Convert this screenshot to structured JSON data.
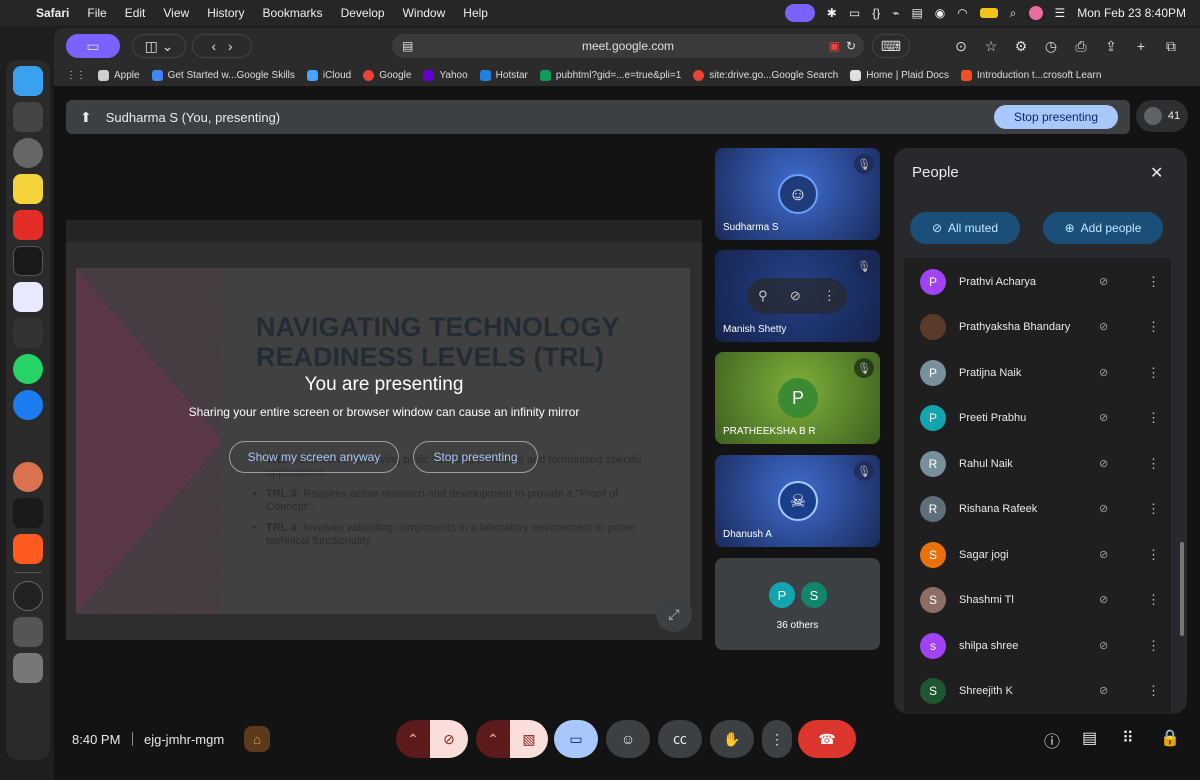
{
  "menubar": {
    "app": "Safari",
    "menus": [
      "File",
      "Edit",
      "View",
      "History",
      "Bookmarks",
      "Develop",
      "Window",
      "Help"
    ],
    "datetime": "Mon Feb 23  8:40PM"
  },
  "browser": {
    "url": "meet.google.com",
    "bookmarks": [
      {
        "label": "Apple",
        "color": "#d0d0d0"
      },
      {
        "label": "Get Started w...Google Skills",
        "color": "#4285f4"
      },
      {
        "label": "iCloud",
        "color": "#4aa3ff"
      },
      {
        "label": "Google",
        "color": "#ea4335"
      },
      {
        "label": "Yahoo",
        "color": "#6001d2"
      },
      {
        "label": "Hotstar",
        "color": "#1f80e0"
      },
      {
        "label": "pubhtml?gid=...e=true&pli=1",
        "color": "#0f9d58"
      },
      {
        "label": "site:drive.go...Google Search",
        "color": "#ea4335"
      },
      {
        "label": "Home | Plaid Docs",
        "color": "#e0e0e0"
      },
      {
        "label": "Introduction t...crosoft Learn",
        "color": "#f25022"
      }
    ]
  },
  "presenting_bar": {
    "text": "Sudharma S (You, presenting)",
    "stop_label": "Stop presenting",
    "participant_count": "41"
  },
  "stage": {
    "slide_title": "NAVIGATING TECHNOLOGY READINESS LEVELS (TRL)",
    "bullets": [
      {
        "strong": "TRL 1-2:",
        "text": " Involve identifying basic scientific principles and formulating specific applications."
      },
      {
        "strong": "TRL 3:",
        "text": " Requires active research and development to provide a \"Proof of Concept\"."
      },
      {
        "strong": "TRL 4:",
        "text": " Involves validating components in a laboratory environment to prove technical functionality."
      }
    ],
    "overlay_title": "You are presenting",
    "overlay_sub": "Sharing your entire screen or browser window can cause an infinity mirror",
    "show_anyway": "Show my screen anyway",
    "stop_presenting": "Stop presenting"
  },
  "tiles": [
    {
      "name": "Sudharma S"
    },
    {
      "name": "Manish Shetty"
    },
    {
      "name": "PRATHEEKSHA B R",
      "initial": "P"
    },
    {
      "name": "Dhanush A"
    },
    {
      "others": "36 others",
      "initials": [
        "P",
        "S"
      ]
    }
  ],
  "people_panel": {
    "title": "People",
    "all_muted": "All muted",
    "add_people": "Add people",
    "people": [
      {
        "name": "Prathvi Acharya",
        "initial": "P",
        "color": "#a142f4"
      },
      {
        "name": "Prathyaksha Bhandary",
        "initial": "",
        "color": "#5a3a2a"
      },
      {
        "name": "Pratijna Naik",
        "initial": "P",
        "color": "#78909c"
      },
      {
        "name": "Preeti Prabhu",
        "initial": "P",
        "color": "#12a4af"
      },
      {
        "name": "Rahul Naik",
        "initial": "R",
        "color": "#78909c"
      },
      {
        "name": "Rishana Rafeek",
        "initial": "R",
        "color": "#5f6f7a"
      },
      {
        "name": "Sagar jogi",
        "initial": "S",
        "color": "#e8710a"
      },
      {
        "name": "Shashmi Tl",
        "initial": "S",
        "color": "#8d6e63"
      },
      {
        "name": "shilpa shree",
        "initial": "s",
        "color": "#a142f4"
      },
      {
        "name": "Shreejith K",
        "initial": "S",
        "color": "#1e5631"
      }
    ]
  },
  "bottom": {
    "time": "8:40 PM",
    "meeting_code": "ejg-jmhr-mgm"
  }
}
